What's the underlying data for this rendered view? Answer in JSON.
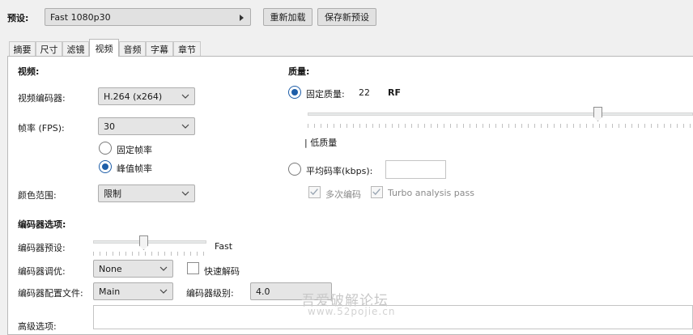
{
  "preset": {
    "label": "预设:",
    "value": "Fast 1080p30",
    "reload_button": "重新加载",
    "save_new_button": "保存新预设"
  },
  "tabs": [
    "摘要",
    "尺寸",
    "滤镜",
    "视频",
    "音频",
    "字幕",
    "章节"
  ],
  "active_tab": 3,
  "video": {
    "section_title": "视频:",
    "codec_label": "视频编码器:",
    "codec_value": "H.264 (x264)",
    "fps_label": "帧率 (FPS):",
    "fps_value": "30",
    "constant_fps": "固定帧率",
    "peak_fps": "峰值帧率",
    "peak_selected": true,
    "color_range_label": "颜色范围:",
    "color_range_value": "限制"
  },
  "quality": {
    "section_title": "质量:",
    "constant_quality_label": "固定质量:",
    "constant_quality_selected": true,
    "quality_value": "22",
    "quality_unit": "RF",
    "slider_position": 0.74,
    "low_quality_label": "| 低质量",
    "avg_bitrate_label": "平均码率(kbps):",
    "avg_bitrate_value": "",
    "multipass_label": "多次编码",
    "multipass_checked": true,
    "turbo_label": "Turbo analysis pass",
    "turbo_checked": true
  },
  "encoder": {
    "section_title": "编码器选项:",
    "preset_label": "编码器预设:",
    "preset_value": "Fast",
    "preset_slider_position": 0.45,
    "tune_label": "编码器调优:",
    "tune_value": "None",
    "fast_decode_label": "快速解码",
    "fast_decode_checked": false,
    "profile_label": "编码器配置文件:",
    "profile_value": "Main",
    "level_label": "编码器级别:",
    "level_value": "4.0",
    "advanced_label": "高级选项:"
  },
  "watermark": {
    "line1": "吾爱破解论坛",
    "line2": "www.52pojie.cn"
  },
  "colors": {
    "accent": "#1e5ea8",
    "panel_bg": "#ffffff",
    "window_bg": "#f0f0f0"
  }
}
